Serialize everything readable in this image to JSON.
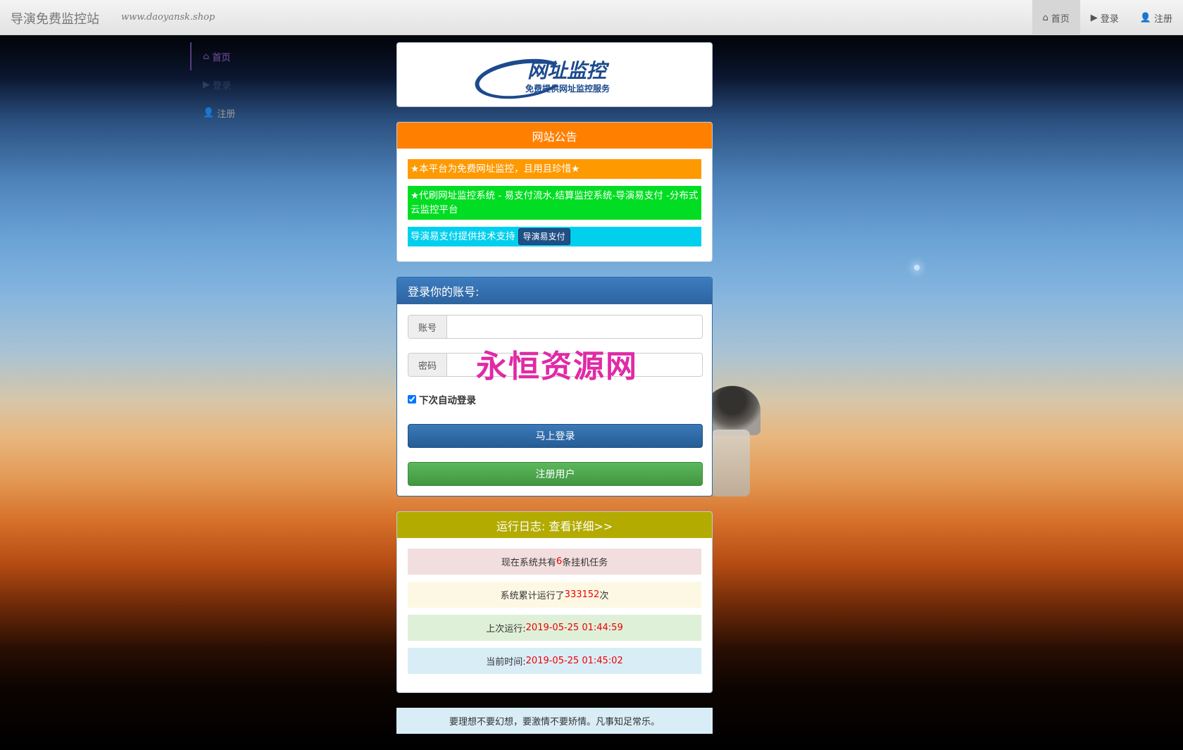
{
  "navbar": {
    "brand": "导演免费监控站",
    "url": "www.daoyansk.shop",
    "items": [
      {
        "icon": "home-icon",
        "label": "首页",
        "active": true
      },
      {
        "icon": "play-icon",
        "label": "登录"
      },
      {
        "icon": "user-icon",
        "label": "注册"
      }
    ]
  },
  "sidebar": {
    "items": [
      {
        "label": "首页"
      },
      {
        "label": "登录"
      },
      {
        "label": "注册"
      }
    ]
  },
  "logo": {
    "main": "网址监控",
    "sub": "免费提供网址监控服务"
  },
  "notice": {
    "title": "网站公告",
    "line1": "★本平台为免费网址监控，且用且珍惜★",
    "line2": "★代刷网址监控系统 - 易支付流水,结算监控系统-导演易支付 -分布式云监控平台",
    "line3": "导演易支付提供技术支持",
    "line3_button": "导演易支付"
  },
  "login": {
    "title": "登录你的账号:",
    "account_label": "账号",
    "account_value": "",
    "password_label": "密码",
    "password_value": "",
    "remember_label": "下次自动登录",
    "remember_checked": true,
    "login_button": "马上登录",
    "register_button": "注册用户",
    "watermark": "永恒资源网"
  },
  "log": {
    "title": "运行日志:  查看详细>>",
    "row1_prefix": "现在系统共有",
    "row1_value": "6",
    "row1_suffix": "条挂机任务",
    "row2_prefix": "系统累计运行了",
    "row2_value": "333152",
    "row2_suffix": "次",
    "row3_prefix": "上次运行:",
    "row3_value": "2019-05-25 01:44:59",
    "row4_prefix": "当前时间:",
    "row4_value": "2019-05-25 01:45:02"
  },
  "footer": {
    "quote": "要理想不要幻想，要激情不要矫情。凡事知足常乐。"
  },
  "colors": {
    "notice_header": "#ff8000",
    "login_header": "#2d64a0",
    "log_header": "#b3ab00",
    "highlight_red": "#ee0000"
  }
}
